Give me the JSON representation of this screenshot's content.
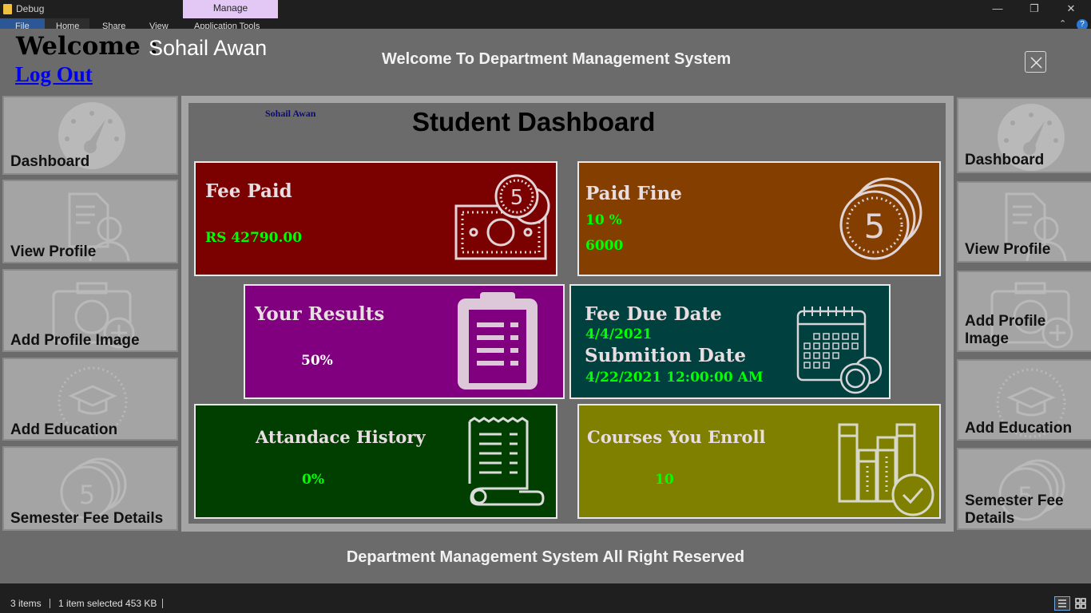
{
  "window": {
    "title": "Debug",
    "context_tab": "Manage",
    "ribbon_tabs": [
      "File",
      "Home",
      "Share",
      "View",
      "Application Tools"
    ],
    "controls": {
      "minimize": "—",
      "restore": "❐",
      "close": "✕"
    }
  },
  "header": {
    "welcome_label": "Welcome :",
    "user_name": "Sohail Awan",
    "logout": "Log Out",
    "app_title": "Welcome To Department Management System"
  },
  "sidebar_left": [
    {
      "label": "Dashboard",
      "icon": "dashboard-gauge-icon"
    },
    {
      "label": "View Profile",
      "icon": "profile-document-icon"
    },
    {
      "label": "Add Profile Image",
      "icon": "camera-add-icon"
    },
    {
      "label": "Add Education",
      "icon": "graduation-cap-icon"
    },
    {
      "label": "Semester Fee Details",
      "icon": "coins-icon"
    }
  ],
  "sidebar_right": [
    {
      "label": "Dashboard",
      "icon": "dashboard-gauge-icon"
    },
    {
      "label": "View Profile",
      "icon": "profile-document-icon"
    },
    {
      "label": "Add Profile\nImage",
      "icon": "camera-add-icon"
    },
    {
      "label": "Add Education",
      "icon": "graduation-cap-icon"
    },
    {
      "label": "Semester Fee\nDetails",
      "icon": "coins-icon"
    }
  ],
  "dashboard": {
    "user_name": "Sohail Awan",
    "title": "Student Dashboard",
    "cards": {
      "fee_paid": {
        "title": "Fee Paid",
        "value": "RS 42790.00",
        "color": "#7b0000",
        "icon": "money-coin-icon"
      },
      "paid_fine": {
        "title": "Paid Fine",
        "percent": "10 %",
        "amount": "6000",
        "color": "#833e00",
        "icon": "coin-stack-icon"
      },
      "results": {
        "title": "Your Results",
        "value": "50%",
        "color": "#800080",
        "icon": "clipboard-icon"
      },
      "fee_due": {
        "title": "Fee Due Date",
        "due_date": "4/4/2021",
        "submission_title": "Submition Date",
        "submission_date": "4/22/2021 12:00:00 AM",
        "color": "#00403f",
        "icon": "calendar-coins-icon"
      },
      "attendance": {
        "title": "Attandace History",
        "value": "0%",
        "color": "#003f00",
        "icon": "receipt-scroll-icon"
      },
      "courses": {
        "title": "Courses You Enroll",
        "value": "10",
        "color": "#7f7f00",
        "icon": "books-check-icon"
      }
    }
  },
  "footer": "Department Management System All Right Reserved",
  "statusbar": {
    "items": "3 items",
    "selected": "1 item selected  453 KB"
  },
  "colors": {
    "accent_value": "#00ff00",
    "app_bg": "#6b6b6b",
    "menu_bg": "#a4a4a4"
  }
}
